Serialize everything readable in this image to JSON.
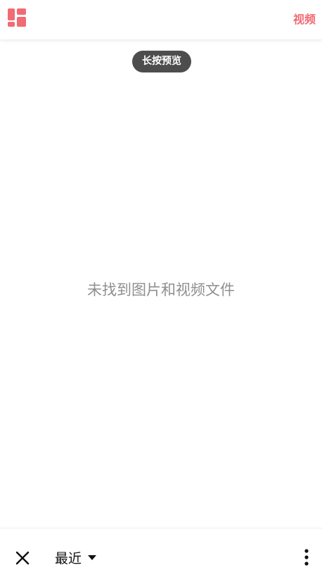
{
  "header": {
    "layout_icon": "layout-grid-icon",
    "video_tab_label": "视频",
    "accent_color": "#f06b74"
  },
  "hint": {
    "label": "长按预览"
  },
  "main": {
    "empty_message": "未找到图片和视频文件"
  },
  "footer": {
    "close_icon": "close-icon",
    "album_label": "最近",
    "dropdown_icon": "caret-down-icon",
    "more_icon": "more-vertical-icon"
  }
}
